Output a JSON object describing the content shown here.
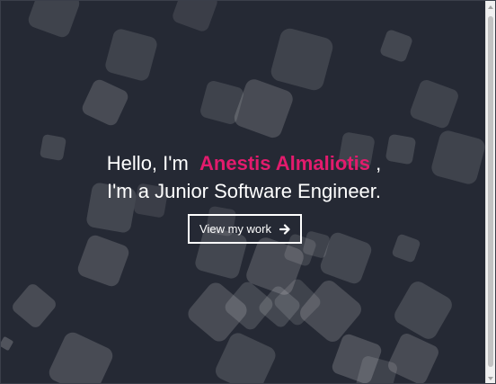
{
  "hero": {
    "greeting_prefix": "Hello, I'm",
    "name": "Anestis Almaliotis",
    "greeting_suffix": ",",
    "role_line": "I'm a Junior Software Engineer."
  },
  "cta": {
    "label": "View my work",
    "icon": "arrow-right-icon"
  },
  "colors": {
    "background": "#252934",
    "accent": "#e31b6d",
    "text": "#ffffff"
  }
}
